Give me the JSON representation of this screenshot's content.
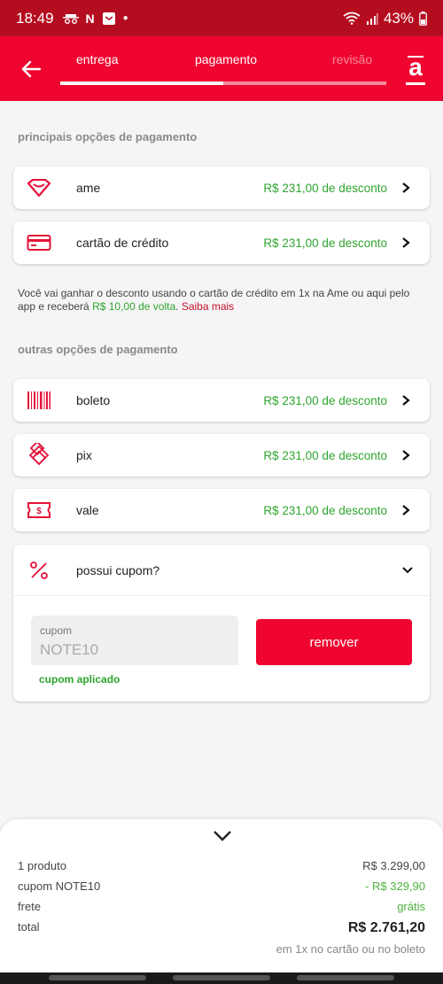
{
  "status": {
    "time": "18:49",
    "battery": "43%"
  },
  "header": {
    "steps": [
      "entrega",
      "pagamento",
      "revisão"
    ],
    "progress": 0.5,
    "brand": "a"
  },
  "sections": {
    "main_title": "principais opções de pagamento",
    "other_title": "outras opções de pagamento"
  },
  "main_options": [
    {
      "label": "ame",
      "discount": "R$ 231,00 de desconto",
      "icon": "ame-heart-icon"
    },
    {
      "label": "cartão de crédito",
      "discount": "R$ 231,00 de desconto",
      "icon": "credit-card-icon"
    }
  ],
  "info": {
    "text_1": "Você vai ganhar o desconto usando o cartão de crédito em 1x na Ame ou aqui pelo app e receberá ",
    "cashback": "R$ 10,00 de volta",
    "text_2": ". ",
    "link": "Saiba mais"
  },
  "other_options": [
    {
      "label": "boleto",
      "discount": "R$ 231,00 de desconto",
      "icon": "barcode-icon"
    },
    {
      "label": "pix",
      "discount": "R$ 231,00 de desconto",
      "icon": "pix-icon"
    },
    {
      "label": "vale",
      "discount": "R$ 231,00 de desconto",
      "icon": "voucher-icon"
    }
  ],
  "coupon": {
    "title": "possui cupom?",
    "field_label": "cupom",
    "value": "NOTE10",
    "status": "cupom aplicado",
    "remove_label": "remover"
  },
  "summary": {
    "rows": [
      {
        "label": "1 produto",
        "value": "R$ 3.299,00"
      },
      {
        "label": "cupom NOTE10",
        "value": "- R$ 329,90"
      },
      {
        "label": "frete",
        "value": "grátis"
      },
      {
        "label": "total",
        "value": "R$ 2.761,20"
      }
    ],
    "note": "em 1x no cartão ou no boleto"
  },
  "colors": {
    "brand_red": "#ef0530",
    "discount_green": "#2ea52e"
  }
}
